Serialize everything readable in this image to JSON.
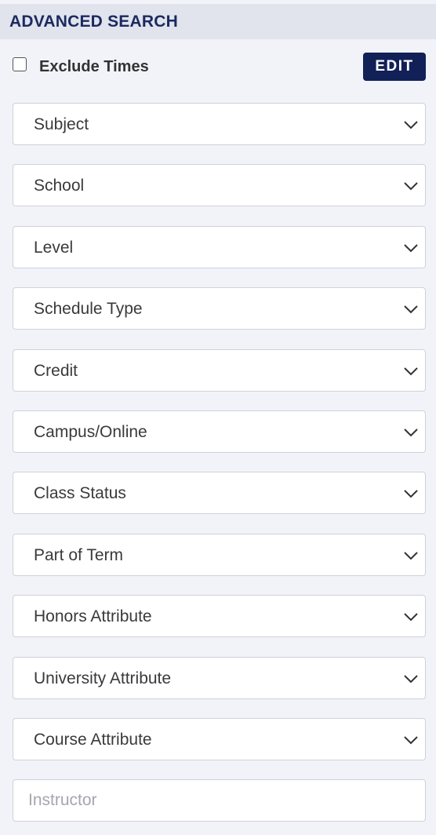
{
  "header": {
    "title": "ADVANCED SEARCH"
  },
  "exclude_times": {
    "label": "Exclude Times",
    "checked": false
  },
  "edit_button": {
    "label": "EDIT"
  },
  "filters": [
    {
      "label": "Subject"
    },
    {
      "label": "School"
    },
    {
      "label": "Level"
    },
    {
      "label": "Schedule Type"
    },
    {
      "label": "Credit"
    },
    {
      "label": "Campus/Online"
    },
    {
      "label": "Class Status"
    },
    {
      "label": "Part of Term"
    },
    {
      "label": "Honors Attribute"
    },
    {
      "label": "University Attribute"
    },
    {
      "label": "Course Attribute"
    }
  ],
  "instructor": {
    "placeholder": "Instructor",
    "value": ""
  },
  "icons": {
    "dropdown": "chevron-down-icon"
  },
  "colors": {
    "brand_navy": "#122058",
    "header_text": "#1b2a5e",
    "header_bg": "#e1e3ed",
    "page_bg": "#f2f3f9"
  }
}
